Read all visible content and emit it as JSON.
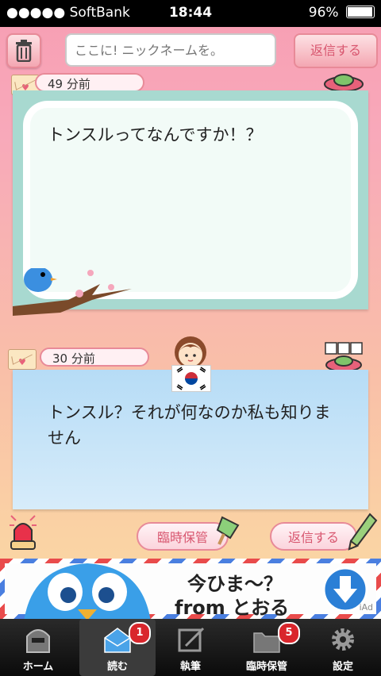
{
  "status_bar": {
    "carrier": "●●●●● SoftBank",
    "time": "18:44",
    "battery": "96%"
  },
  "top_bar": {
    "nickname_placeholder": "ここに! ニックネームを。",
    "reply_label": "返信する"
  },
  "messages": [
    {
      "time_ago": "49 分前",
      "text": "トンスルってなんですか！？"
    },
    {
      "time_ago": "30 分前",
      "text": "トンスル？それが何なのか私も知りません"
    }
  ],
  "actions": {
    "save_label": "臨時保管",
    "reply_label": "返信する"
  },
  "ad": {
    "line1": "今ひま〜？",
    "line2": "from とおる",
    "iad": "iAd"
  },
  "tabs": [
    {
      "label": "ホーム",
      "badge": ""
    },
    {
      "label": "読む",
      "badge": "1"
    },
    {
      "label": "執筆",
      "badge": ""
    },
    {
      "label": "臨時保管",
      "badge": "5"
    },
    {
      "label": "設定",
      "badge": ""
    }
  ],
  "colors": {
    "accent_pink": "#e88a98",
    "card_green": "#a8d9d0",
    "card_blue": "#b6dcf6",
    "badge_red": "#d9262c"
  }
}
